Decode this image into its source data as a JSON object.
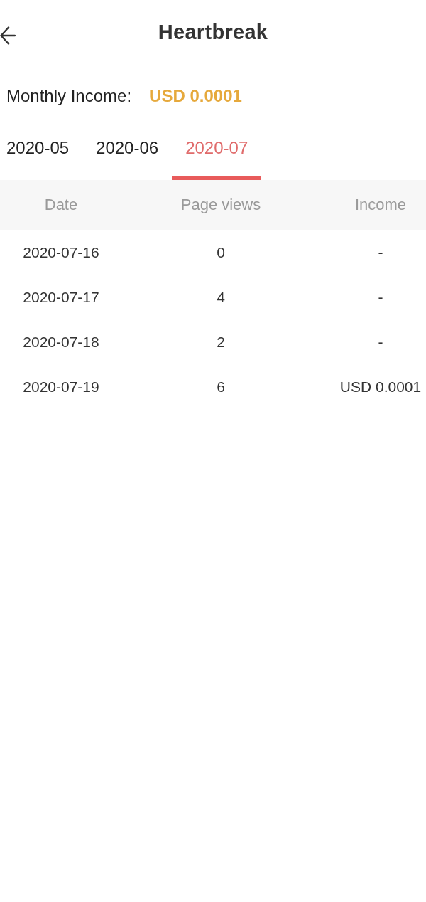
{
  "header": {
    "title": "Heartbreak"
  },
  "summary": {
    "label": "Monthly Income:",
    "value": "USD 0.0001"
  },
  "tabs": [
    {
      "label": "2020-05",
      "selected": false
    },
    {
      "label": "2020-06",
      "selected": false
    },
    {
      "label": "2020-07",
      "selected": true
    }
  ],
  "table": {
    "columns": [
      "Date",
      "Page views",
      "Income"
    ],
    "rows": [
      [
        "2020-07-16",
        "0",
        "-"
      ],
      [
        "2020-07-17",
        "4",
        "-"
      ],
      [
        "2020-07-18",
        "2",
        "-"
      ],
      [
        "2020-07-19",
        "6",
        "USD 0.0001"
      ]
    ]
  }
}
